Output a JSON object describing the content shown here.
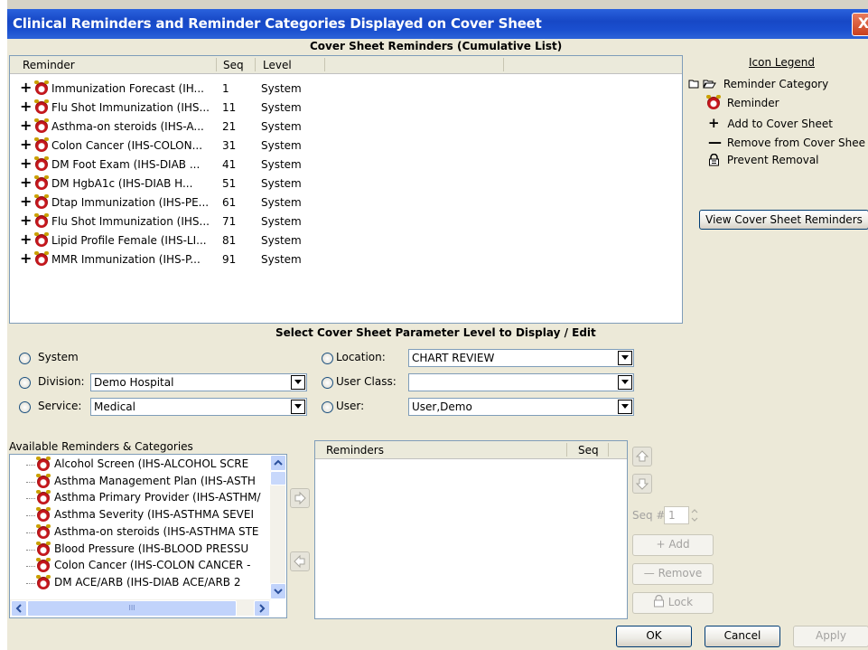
{
  "window": {
    "title": "Clinical Reminders and Reminder Categories Displayed on Cover Sheet",
    "close_label": "X"
  },
  "cover_sheet": {
    "heading": "Cover Sheet Reminders (Cumulative List)",
    "columns": {
      "reminder": "Reminder",
      "seq": "Seq",
      "level": "Level"
    },
    "rows": [
      {
        "name": "Immunization Forecast (IH...",
        "seq": "1",
        "level": "System"
      },
      {
        "name": "Flu Shot Immunization (IHS...",
        "seq": "11",
        "level": "System"
      },
      {
        "name": "Asthma-on steroids (IHS-A...",
        "seq": "21",
        "level": "System"
      },
      {
        "name": "Colon Cancer (IHS-COLON...",
        "seq": "31",
        "level": "System"
      },
      {
        "name": "DM Foot Exam (IHS-DIAB ...",
        "seq": "41",
        "level": "System"
      },
      {
        "name": "DM HgbA1c (IHS-DIAB H...",
        "seq": "51",
        "level": "System"
      },
      {
        "name": "Dtap Immunization (IHS-PE...",
        "seq": "61",
        "level": "System"
      },
      {
        "name": "Flu Shot Immunization (IHS...",
        "seq": "71",
        "level": "System"
      },
      {
        "name": "Lipid Profile Female (IHS-LI...",
        "seq": "81",
        "level": "System"
      },
      {
        "name": "MMR Immunization (IHS-P...",
        "seq": "91",
        "level": "System"
      }
    ],
    "add_symbol": "+"
  },
  "legend": {
    "title": "Icon Legend",
    "items": {
      "category": "Reminder Category",
      "reminder": "Reminder",
      "add": "Add to Cover Sheet",
      "remove": "Remove from Cover Shee",
      "prevent": "Prevent Removal"
    },
    "view_button": "View Cover Sheet Reminders"
  },
  "param": {
    "heading": "Select Cover Sheet Parameter Level to Display / Edit",
    "system_label": "System",
    "division_label": "Division:",
    "division_value": "Demo Hospital",
    "service_label": "Service:",
    "service_value": "Medical",
    "location_label": "Location:",
    "location_value": "CHART REVIEW",
    "userclass_label": "User Class:",
    "userclass_value": "",
    "user_label": "User:",
    "user_value": "User,Demo"
  },
  "available": {
    "heading": "Available Reminders & Categories",
    "items": [
      "Alcohol Screen (IHS-ALCOHOL SCRE",
      "Asthma Management Plan (IHS-ASTH",
      "Asthma Primary Provider (IHS-ASTHM/",
      "Asthma Severity (IHS-ASTHMA SEVEI",
      "Asthma-on steroids (IHS-ASTHMA STE",
      "Blood Pressure (IHS-BLOOD PRESSU",
      "Colon Cancer (IHS-COLON CANCER -",
      "DM ACE/ARB (IHS-DIAB ACE/ARB 2"
    ],
    "hscroll_grip": "III"
  },
  "selected": {
    "columns": {
      "reminders": "Reminders",
      "seq": "Seq"
    }
  },
  "edit": {
    "seq_label": "Seq #",
    "seq_value": "1",
    "add": "Add",
    "remove": "Remove",
    "lock": "Lock",
    "add_symbol": "+",
    "remove_symbol": "—"
  },
  "footer": {
    "ok": "OK",
    "cancel": "Cancel",
    "apply": "Apply"
  },
  "colors": {
    "titlebar": "#1748c6",
    "dialog_bg": "#ece9d8",
    "reminder_icon": "#c4161c"
  }
}
